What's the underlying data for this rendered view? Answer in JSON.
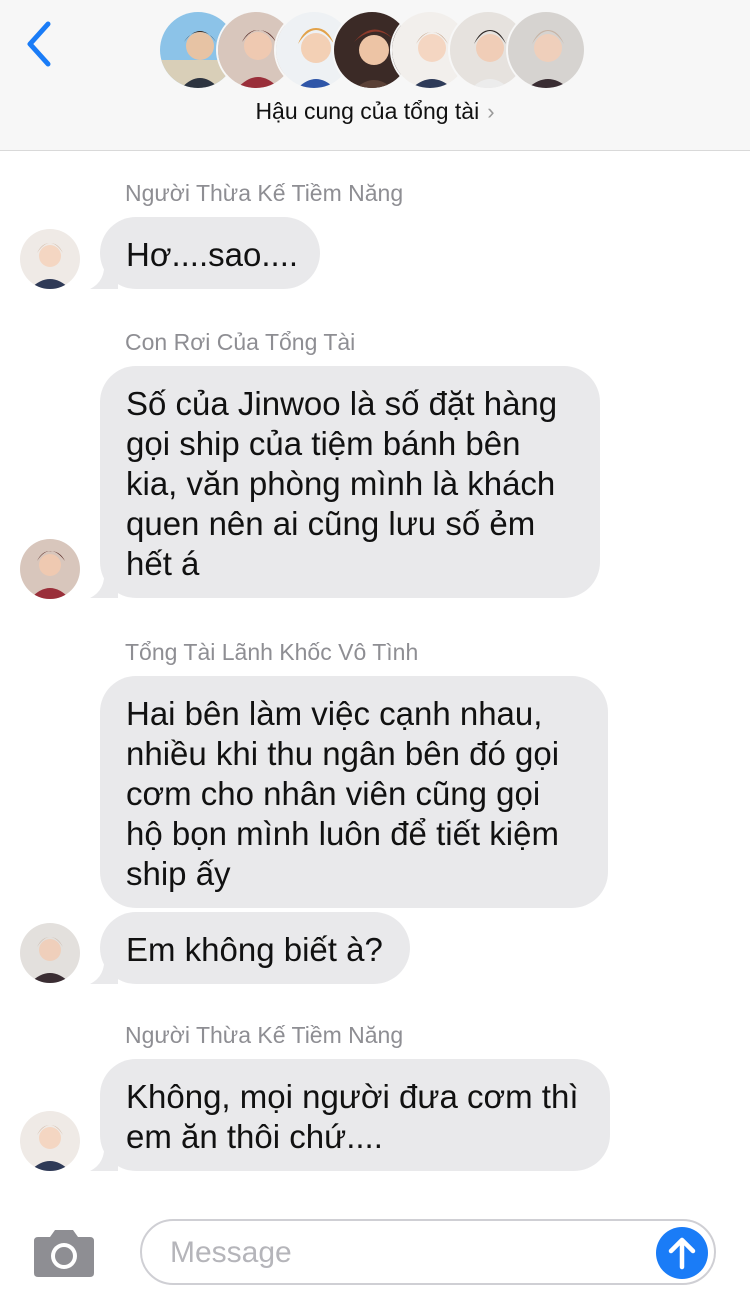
{
  "header": {
    "back_icon": "chevron-left-icon",
    "title": "Hậu cung của tổng tài",
    "title_chevron": "›",
    "accent_color": "#1a7cf7",
    "avatar_count": 7
  },
  "messages": [
    {
      "sender": "Người Thừa Kế Tiềm Năng",
      "lines": [
        "Hơ....sao...."
      ]
    },
    {
      "sender": "Con Rơi Của Tổng Tài",
      "lines": [
        "Số của Jinwoo là số đặt hàng",
        "gọi ship của tiệm bánh bên",
        "kia, văn phòng mình là khách",
        "quen nên ai cũng lưu số ẻm",
        "hết á"
      ]
    },
    {
      "sender": "Tổng Tài Lãnh Khốc Vô Tình",
      "lines": [
        "Hai bên làm việc cạnh nhau,",
        "nhiều khi thu ngân bên đó gọi",
        "cơm cho nhân viên cũng gọi",
        "hộ bọn mình luôn để tiết kiệm",
        "ship ấy"
      ]
    },
    {
      "sender": "",
      "lines": [
        "Em không biết à?"
      ]
    },
    {
      "sender": "Người Thừa Kế Tiềm Năng",
      "lines": [
        "Không, mọi người đưa cơm thì",
        "em ăn thôi chứ...."
      ]
    }
  ],
  "composer": {
    "placeholder": "Message",
    "camera_icon": "camera-icon",
    "send_icon": "arrow-up-icon"
  },
  "colors": {
    "bubble": "#e9e9eb",
    "sender_text": "#8e8e93",
    "header_bg": "#f7f7f7"
  }
}
